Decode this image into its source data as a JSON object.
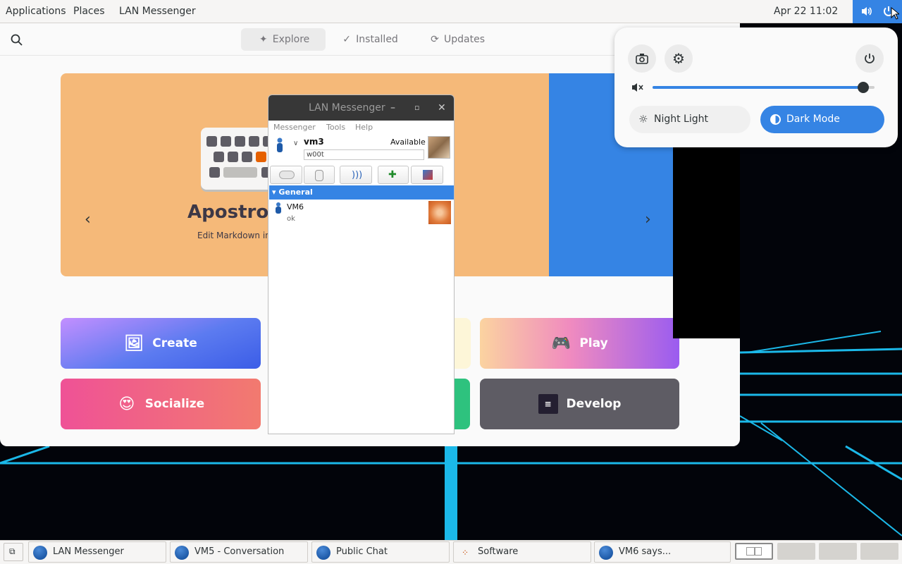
{
  "topbar": {
    "applications": "Applications",
    "places": "Places",
    "active_app": "LAN Messenger",
    "clock": "Apr 22  11:02"
  },
  "software": {
    "tabs": [
      {
        "label": "Explore",
        "icon": "explore-icon"
      },
      {
        "label": "Installed",
        "icon": "check-icon"
      },
      {
        "label": "Updates",
        "icon": "refresh-icon"
      }
    ],
    "banner": {
      "title": "Apostrop",
      "subtitle": "Edit Markdown in s",
      "color": "#f5b979"
    },
    "categories": [
      {
        "label": "Create",
        "icon": "create-icon"
      },
      {
        "label": "Play",
        "icon": "gamepad-icon"
      },
      {
        "label": "Socialize",
        "icon": "heart-eyes-icon"
      },
      {
        "label": "Develop",
        "icon": "terminal-icon"
      }
    ]
  },
  "lan": {
    "title": "LAN Messenger",
    "menu": [
      "Messenger",
      "Tools",
      "Help"
    ],
    "user": {
      "name": "vm3",
      "status": "Available",
      "note": "w00t"
    },
    "group": "General",
    "contacts": [
      {
        "name": "VM6",
        "note": "ok"
      }
    ]
  },
  "quick_settings": {
    "volume": 0.95,
    "night_light": "Night Light",
    "dark_mode": "Dark Mode",
    "accent": "#3584e4"
  },
  "taskbar": {
    "tasks": [
      {
        "label": "LAN Messenger"
      },
      {
        "label": "VM5 - Conversation"
      },
      {
        "label": "Public Chat"
      },
      {
        "label": "Software"
      },
      {
        "label": "VM6 says..."
      }
    ]
  }
}
